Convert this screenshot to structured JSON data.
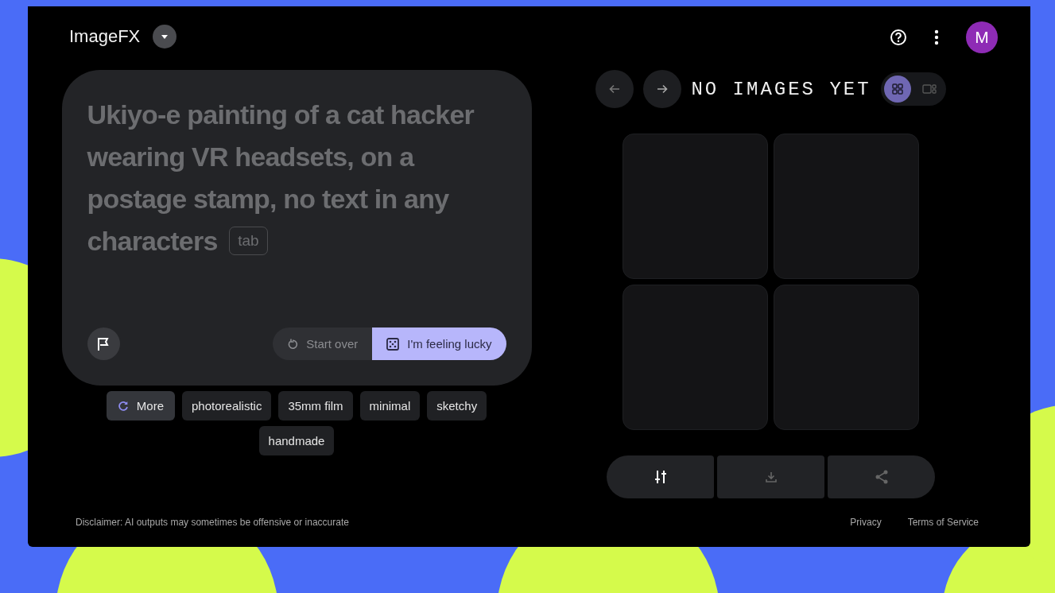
{
  "app": {
    "title": "ImageFX",
    "avatar_initial": "M"
  },
  "prompt": {
    "placeholder": "Ukiyo-e painting of a cat hacker wearing VR headsets, on a postage stamp, no text in any characters",
    "key_hint": "tab"
  },
  "prompt_actions": [
    {
      "kind": "restart",
      "label": "Start over",
      "selected": false
    },
    {
      "kind": "dice",
      "label": "I'm feeling lucky",
      "selected": true
    }
  ],
  "chips": [
    {
      "kind": "refresh",
      "label": "More"
    },
    {
      "kind": "style",
      "label": "photorealistic"
    },
    {
      "kind": "style",
      "label": "35mm film"
    },
    {
      "kind": "style",
      "label": "minimal"
    },
    {
      "kind": "style",
      "label": "sketchy"
    },
    {
      "kind": "style",
      "label": "handmade"
    }
  ],
  "results": {
    "status": "NO IMAGES YET",
    "view_options": [
      {
        "kind": "grid",
        "selected": true
      },
      {
        "kind": "single",
        "selected": false
      }
    ],
    "tiles": [
      {
        "kind": "empty"
      },
      {
        "kind": "empty"
      },
      {
        "kind": "empty"
      },
      {
        "kind": "empty"
      }
    ]
  },
  "footer": {
    "disclaimer": "Disclaimer: AI outputs may sometimes be offensive or inaccurate",
    "links": [
      "Privacy",
      "Terms of Service"
    ]
  }
}
